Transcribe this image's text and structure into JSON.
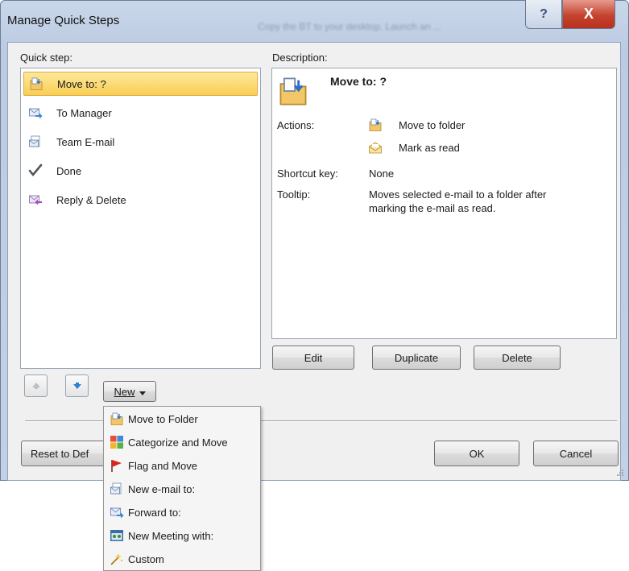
{
  "window": {
    "title": "Manage Quick Steps",
    "background_title": "Copy the BT to your desktop. Launch an ...",
    "help_symbol": "?",
    "close_symbol": "X"
  },
  "quick_step": {
    "label": "Quick step:",
    "items": [
      {
        "label": "Move to: ?",
        "icon": "move-folder-icon",
        "selected": true
      },
      {
        "label": "To Manager",
        "icon": "forward-mail-icon"
      },
      {
        "label": "Team E-mail",
        "icon": "new-mail-icon"
      },
      {
        "label": "Done",
        "icon": "checkmark-icon"
      },
      {
        "label": "Reply & Delete",
        "icon": "reply-delete-icon"
      }
    ]
  },
  "description": {
    "label": "Description:",
    "title": "Move to: ?",
    "actions_label": "Actions:",
    "actions": [
      {
        "label": "Move to folder",
        "icon": "move-folder-icon"
      },
      {
        "label": "Mark as read",
        "icon": "open-envelope-icon"
      }
    ],
    "shortcut_label": "Shortcut key:",
    "shortcut_value": "None",
    "tooltip_label": "Tooltip:",
    "tooltip_line1": "Moves selected e-mail to a folder after",
    "tooltip_line2": "marking the e-mail as read."
  },
  "buttons": {
    "edit": "Edit",
    "duplicate": "Duplicate",
    "delete": "Delete",
    "new": "New",
    "reset": "Reset to Def",
    "ok": "OK",
    "cancel": "Cancel"
  },
  "new_menu": {
    "items": [
      {
        "label": "Move to Folder",
        "icon": "move-folder-icon"
      },
      {
        "label": "Categorize and Move",
        "icon": "categorize-icon"
      },
      {
        "label": "Flag and Move",
        "icon": "flag-icon"
      },
      {
        "label": "New e-mail to:",
        "icon": "new-mail-icon"
      },
      {
        "label": "Forward to:",
        "icon": "forward-mail-icon"
      },
      {
        "label": "New Meeting with:",
        "icon": "meeting-icon"
      },
      {
        "label": "Custom",
        "icon": "custom-icon"
      }
    ]
  },
  "colors": {
    "selection": "#f8cf55",
    "close_button": "#c5432e",
    "frame": "#c3d1e6"
  }
}
